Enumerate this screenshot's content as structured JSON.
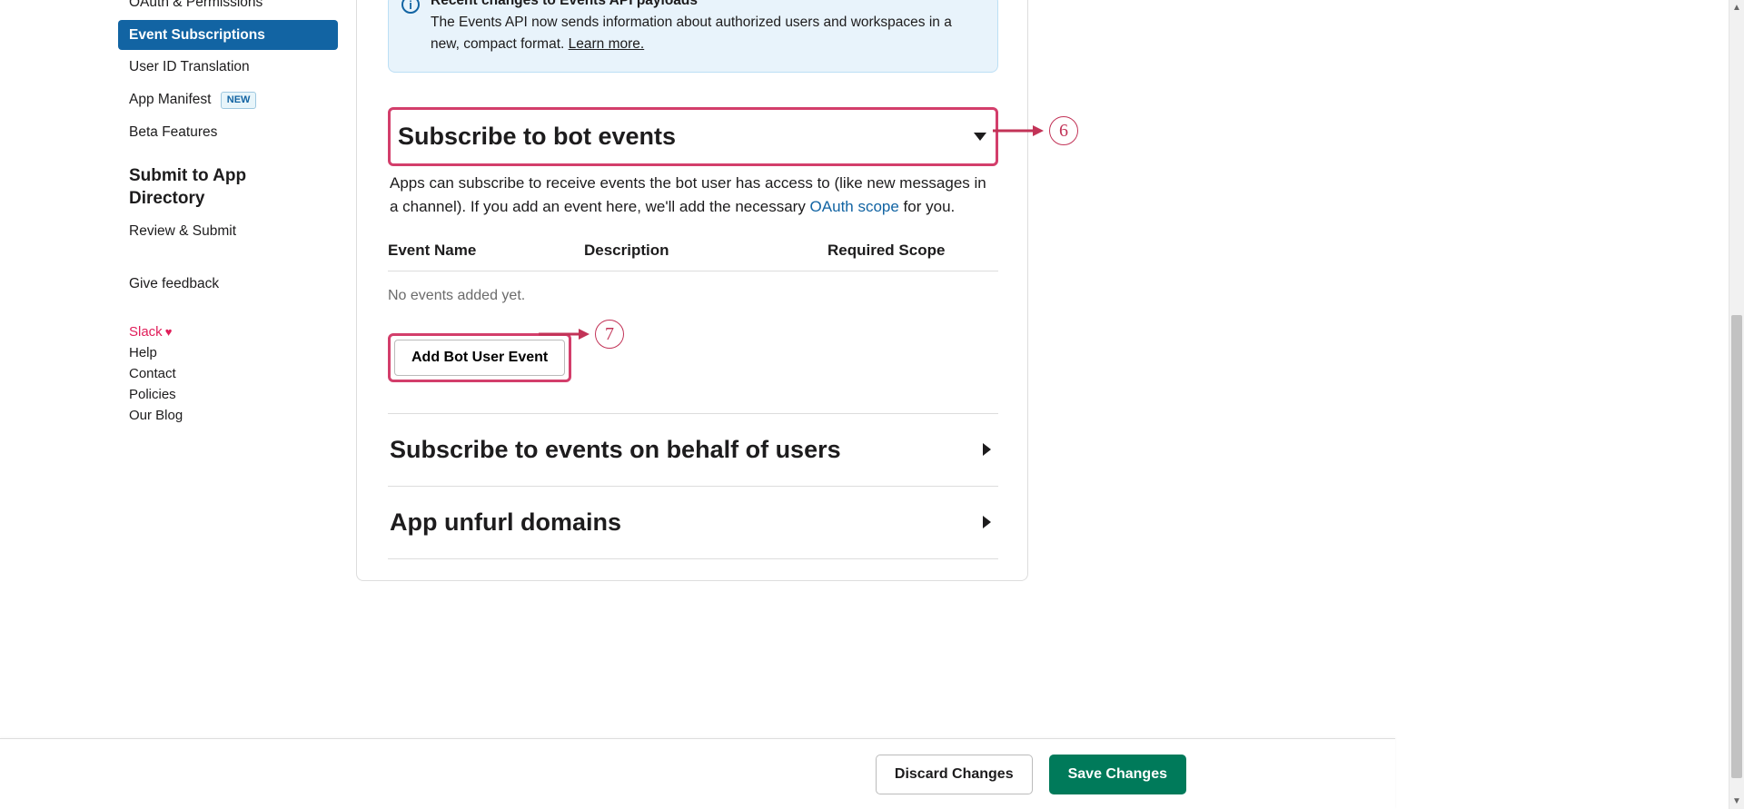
{
  "sidebar": {
    "items": [
      {
        "label": "OAuth & Permissions"
      },
      {
        "label": "Event Subscriptions"
      },
      {
        "label": "User ID Translation"
      },
      {
        "label": "App Manifest",
        "badge": "NEW"
      },
      {
        "label": "Beta Features"
      }
    ],
    "heading": "Submit to App Directory",
    "review": "Review & Submit",
    "feedback": "Give feedback",
    "footer": {
      "slack": "Slack",
      "help": "Help",
      "contact": "Contact",
      "policies": "Policies",
      "blog": "Our Blog"
    }
  },
  "banner": {
    "title": "Recent changes to Events API payloads",
    "body": "The Events API now sends information about authorized users and workspaces in a new, compact format. ",
    "link": "Learn more."
  },
  "botEvents": {
    "title": "Subscribe to bot events",
    "desc_before": "Apps can subscribe to receive events the bot user has access to (like new messages in a channel). If you add an event here, we'll add the necessary ",
    "desc_link": "OAuth scope",
    "desc_after": " for you.",
    "cols": {
      "c1": "Event Name",
      "c2": "Description",
      "c3": "Required Scope"
    },
    "empty": "No events added yet.",
    "add_button": "Add Bot User Event"
  },
  "userEvents": {
    "title": "Subscribe to events on behalf of users"
  },
  "unfurl": {
    "title": "App unfurl domains"
  },
  "callouts": {
    "six": "6",
    "seven": "7"
  },
  "buttons": {
    "discard": "Discard Changes",
    "save": "Save Changes"
  }
}
